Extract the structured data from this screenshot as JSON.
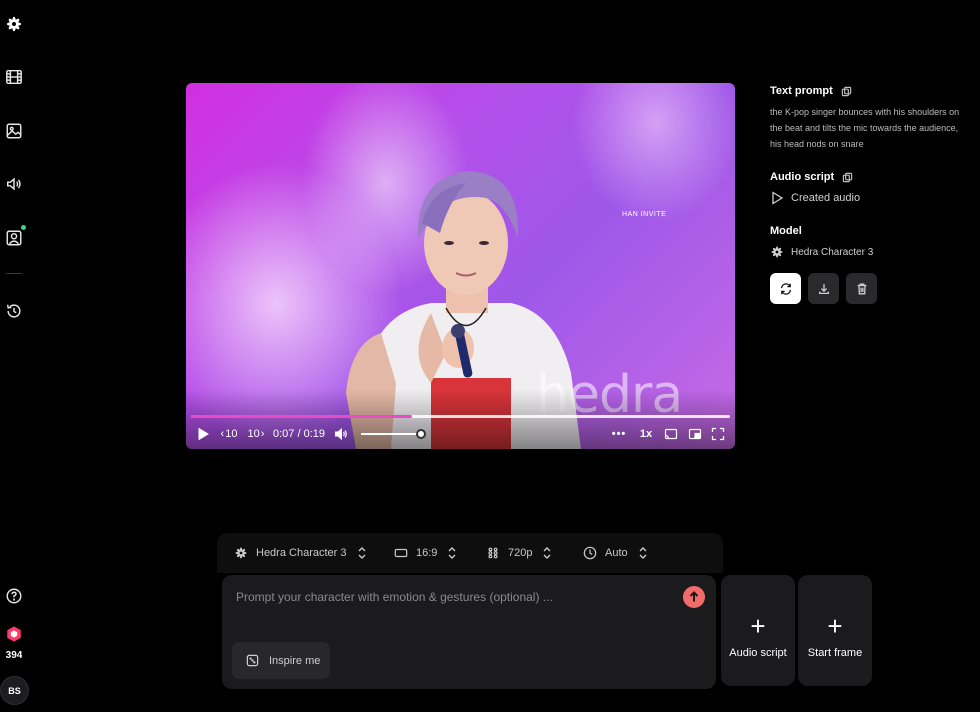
{
  "sidebar": {
    "credits": "394",
    "avatar_initials": "BS"
  },
  "video": {
    "watermark_small": "HAN INVITE",
    "watermark": "hedra",
    "rewind_label": "10",
    "forward_label": "10",
    "time": "0:07 / 0:19",
    "speed": "1x",
    "progress": 0.41,
    "volume": 0.93
  },
  "panel": {
    "text_prompt_heading": "Text prompt",
    "text_prompt": "the K-pop singer bounces with his shoulders on the beat and tilts the mic towards the audience, his head nods on snare",
    "audio_script_heading": "Audio script",
    "audio_label": "Created audio",
    "model_heading": "Model",
    "model_name": "Hedra Character 3"
  },
  "settings": {
    "model": "Hedra Character 3",
    "aspect": "16:9",
    "resolution": "720p",
    "duration": "Auto"
  },
  "composer": {
    "placeholder": "Prompt your character with emotion & gestures (optional) ...",
    "inspire": "Inspire me"
  },
  "cards": {
    "audio_script": "Audio script",
    "start_frame": "Start frame"
  },
  "colors": {
    "accent_pink": "#e94ac8",
    "send_button": "#f26b6b",
    "status_dot": "#3fd18b",
    "credits_badge": "#ff3b6b"
  }
}
